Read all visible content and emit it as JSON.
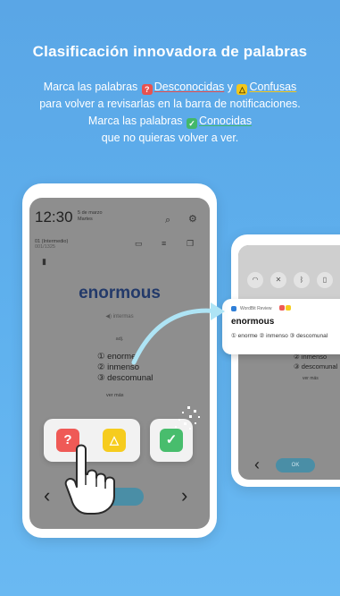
{
  "headline": "Clasificación innovadora de palabras",
  "subtitle": {
    "line1_a": "Marca las palabras ",
    "line1_b": "Desconocidas",
    "line1_c": " y ",
    "line1_d": "Confusas",
    "line2": "para volver a revisarlas en la barra de notificaciones.",
    "line3_a": "Marca las palabras ",
    "line3_b": "Conocidas",
    "line4": "que no quieras volver a ver."
  },
  "left_phone": {
    "time": "12:30",
    "date_line1": "5 de marzo",
    "date_line2": "Martes",
    "wordbook_line1": "01 (Intermedio)",
    "wordbook_line2": "001/1325",
    "word": "enormous",
    "pronunciation": "intermas",
    "part_of_speech": "adj.",
    "meanings": [
      "① enorme",
      "② inmenso",
      "③ descomunal"
    ],
    "see_more": "ver más",
    "buttons": {
      "unknown": "?",
      "confusing": "△",
      "known": "✓"
    },
    "nav_prev": "‹",
    "nav_next": "›"
  },
  "right_phone": {
    "notification_app": "WordBit Review",
    "notification_word": "enormous",
    "notification_meanings": "① enorme ② inmenso ③ descomunal",
    "meanings": [
      "② inmenso",
      "③ descomunal"
    ],
    "see_more": "ver más",
    "toggle_label": "OK",
    "nav_prev": "‹"
  },
  "colors": {
    "unknown": "#ef5a56",
    "confusing": "#f6cc1e",
    "known": "#48bd6d",
    "background": "#5fb1ee"
  }
}
